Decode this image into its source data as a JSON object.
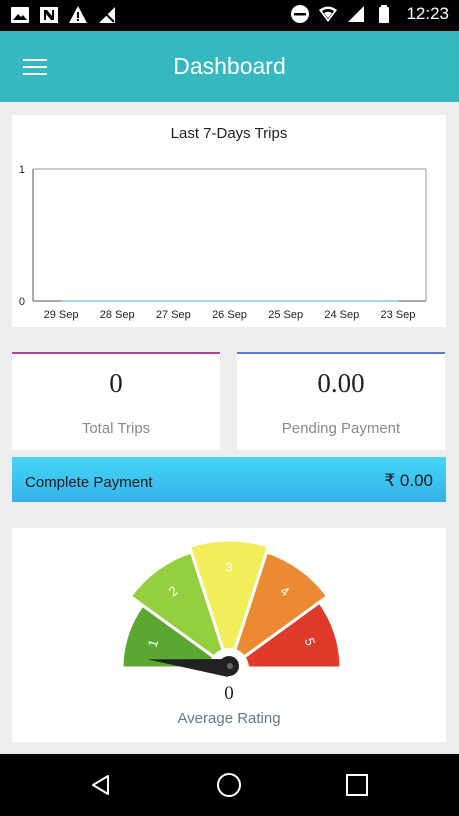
{
  "status_bar": {
    "time": "12:23",
    "left_icons": [
      "image-icon",
      "n-app-icon",
      "warning-icon",
      "no-signal-icon"
    ],
    "right_icons": [
      "do-not-disturb-icon",
      "wifi-icon",
      "signal-icon",
      "battery-icon"
    ]
  },
  "header": {
    "title": "Dashboard",
    "menu_icon": "hamburger-menu-icon",
    "color": "#36b8c0"
  },
  "chart_data": {
    "type": "line",
    "title": "Last 7-Days Trips",
    "categories": [
      "29 Sep",
      "28 Sep",
      "27 Sep",
      "26 Sep",
      "25 Sep",
      "24 Sep",
      "23 Sep"
    ],
    "series": [
      {
        "values": [
          0,
          0,
          0,
          0,
          0,
          0,
          0
        ]
      }
    ],
    "ylim": [
      0,
      1
    ],
    "yticks": [
      "0",
      "1"
    ],
    "xlabel": "",
    "ylabel": "",
    "grid": false,
    "legend": "none"
  },
  "stats": {
    "total_trips": {
      "value": "0",
      "label": "Total Trips",
      "accent": "#b2419a"
    },
    "pending_payment": {
      "value": "0.00",
      "label": "Pending Payment",
      "accent": "#5a78d6"
    }
  },
  "complete_payment": {
    "label": "Complete Payment",
    "amount": "₹ 0.00"
  },
  "rating": {
    "value": 0,
    "value_text": "0",
    "label": "Average Rating",
    "scale_labels": [
      "1",
      "2",
      "3",
      "4",
      "5"
    ],
    "segment_colors": [
      "#5aa832",
      "#93cf3f",
      "#f2ed5a",
      "#ec8a33",
      "#e03a2a"
    ]
  },
  "nav": {
    "back": "back-triangle-icon",
    "home": "home-circle-icon",
    "recents": "recents-square-icon"
  }
}
